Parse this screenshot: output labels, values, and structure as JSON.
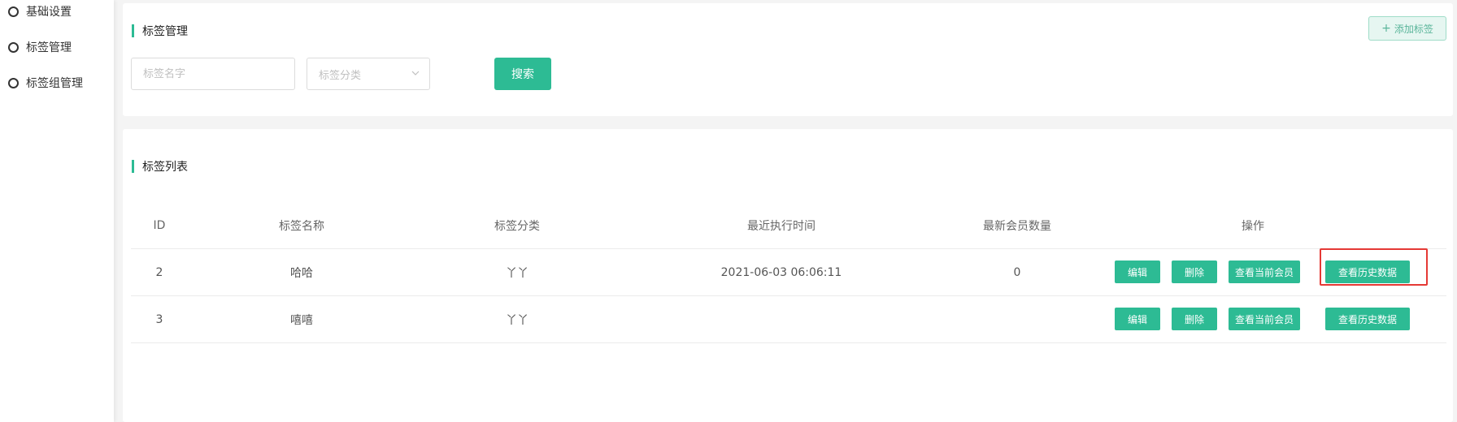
{
  "sidebar": {
    "items": [
      {
        "label": "基础设置"
      },
      {
        "label": "标签管理"
      },
      {
        "label": "标签组管理"
      }
    ]
  },
  "search_panel": {
    "title": "标签管理",
    "add_button_label": "添加标签",
    "tag_name_placeholder": "标签名字",
    "category_placeholder": "标签分类",
    "search_button_label": "搜索"
  },
  "list_panel": {
    "title": "标签列表",
    "columns": [
      "ID",
      "标签名称",
      "标签分类",
      "最近执行时间",
      "最新会员数量",
      "操作"
    ],
    "rows": [
      {
        "id": "2",
        "name": "哈哈",
        "category": "丫丫",
        "last_run": "2021-06-03 06:06:11",
        "member_count": "0"
      },
      {
        "id": "3",
        "name": "嘻嘻",
        "category": "丫丫",
        "last_run": "",
        "member_count": ""
      }
    ],
    "actions": {
      "edit": "编辑",
      "delete": "删除",
      "view_members": "查看当前会员",
      "view_history": "查看历史数据"
    }
  },
  "colors": {
    "accent": "#2dbb94",
    "highlight": "#e53935"
  }
}
